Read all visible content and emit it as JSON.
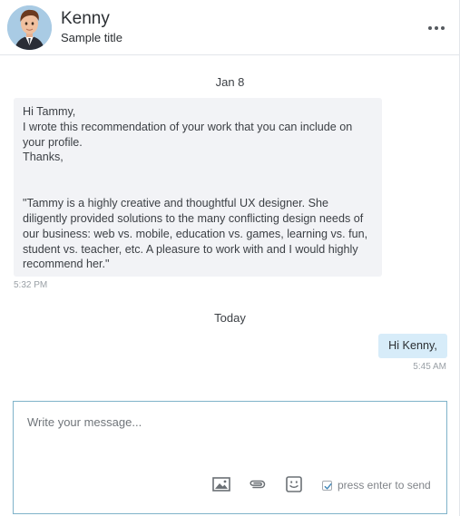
{
  "header": {
    "name": "Kenny",
    "subtitle": "Sample title",
    "more_icon": "more-horizontal-icon"
  },
  "conversation": {
    "separators": [
      "Jan 8",
      "Today"
    ],
    "incoming": {
      "lines": [
        "Hi Tammy,",
        "I wrote this recommendation of your work that you can include on your profile.",
        "Thanks,",
        "\"Tammy is a highly creative and thoughtful UX designer. She diligently provided solutions to the many conflicting design needs of our business: web vs. mobile, education vs. games, learning vs. fun, student vs. teacher, etc. A pleasure to work with and I would highly recommend her.\""
      ],
      "time": "5:32 PM"
    },
    "outgoing": {
      "text": "Hi Kenny,",
      "time": "5:45 AM"
    }
  },
  "composer": {
    "placeholder": "Write your message...",
    "value": "",
    "tools": [
      "image-icon",
      "attachment-icon",
      "emoji-icon"
    ],
    "enter_label": "press enter to send",
    "enter_checked": true
  },
  "colors": {
    "incoming_bubble": "#f2f3f6",
    "outgoing_bubble": "#d7ecf9",
    "composer_border": "#7fb3c9"
  }
}
